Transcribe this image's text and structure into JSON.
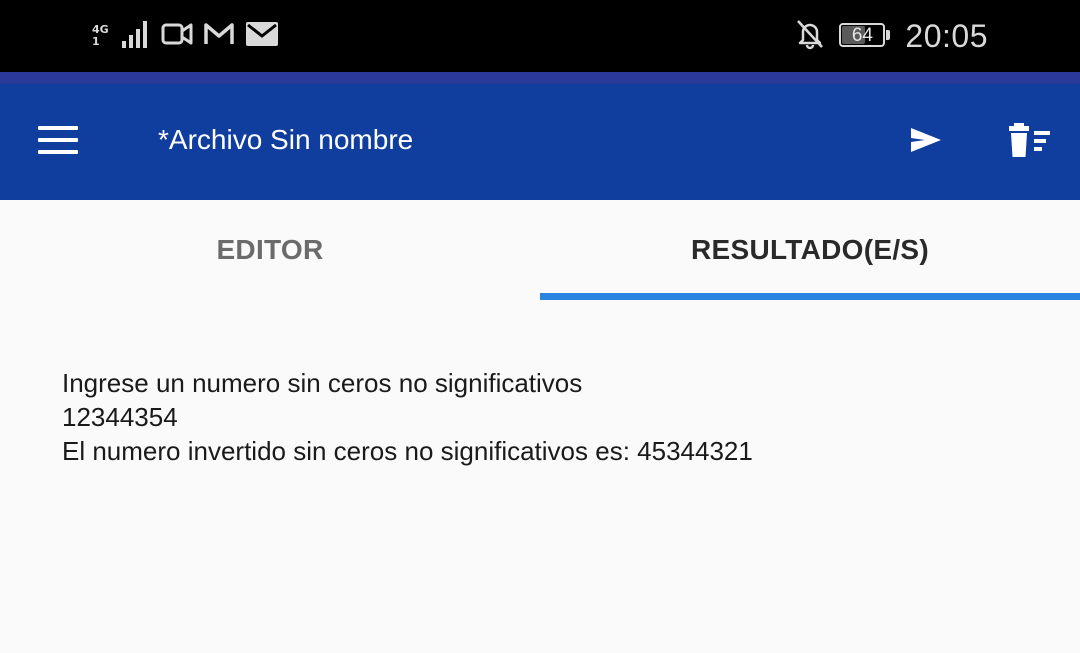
{
  "status_bar": {
    "network_type": "4G",
    "network_sub": "1",
    "battery_level": "64",
    "battery_fraction": 0.64,
    "time": "20:05",
    "icons": [
      "signal-icon",
      "video-camera-icon",
      "gmail-icon",
      "mail-icon",
      "notifications-off-icon",
      "battery-icon"
    ]
  },
  "app_bar": {
    "title": "*Archivo Sin nombre",
    "background": "#103e9e",
    "icons": [
      "menu-icon",
      "play-icon",
      "clear-all-icon"
    ]
  },
  "tabs": {
    "items": [
      {
        "label": "EDITOR",
        "selected": false
      },
      {
        "label": "RESULTADO(E/S)",
        "selected": true
      }
    ],
    "indicator_color": "#2a84e0"
  },
  "output": {
    "lines": [
      "Ingrese un numero sin ceros no significativos",
      "12344354",
      "El numero invertido sin ceros no significativos es: 45344321"
    ]
  }
}
